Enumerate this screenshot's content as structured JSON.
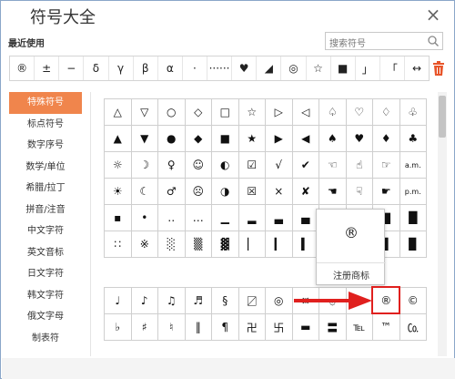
{
  "window": {
    "title": "符号大全",
    "close_glyph": "×"
  },
  "recent": {
    "label": "最近使用",
    "items": [
      "®",
      "±",
      "−",
      "δ",
      "γ",
      "β",
      "α",
      "·",
      "······",
      "♥",
      "◢",
      "◎",
      "☆",
      "■",
      "」",
      "「",
      "↔"
    ]
  },
  "search": {
    "placeholder": "搜索符号"
  },
  "sidebar": {
    "items": [
      {
        "label": "特殊符号",
        "active": true
      },
      {
        "label": "标点符号",
        "active": false
      },
      {
        "label": "数字序号",
        "active": false
      },
      {
        "label": "数学/单位",
        "active": false
      },
      {
        "label": "希腊/拉丁",
        "active": false
      },
      {
        "label": "拼音/注音",
        "active": false
      },
      {
        "label": "中文字符",
        "active": false
      },
      {
        "label": "英文音标",
        "active": false
      },
      {
        "label": "日文字符",
        "active": false
      },
      {
        "label": "韩文字符",
        "active": false
      },
      {
        "label": "俄文字母",
        "active": false
      },
      {
        "label": "制表符",
        "active": false
      }
    ]
  },
  "grid_top": [
    [
      "△",
      "▽",
      "○",
      "◇",
      "□",
      "☆",
      "▷",
      "◁",
      "♤",
      "♡",
      "♢",
      "♧"
    ],
    [
      "▲",
      "▼",
      "●",
      "◆",
      "■",
      "★",
      "▶",
      "◀",
      "♠",
      "♥",
      "♦",
      "♣"
    ],
    [
      "☼",
      "☽",
      "♀",
      "☺",
      "◐",
      "☑",
      "√",
      "✔",
      "☜",
      "☝",
      "☞",
      "a.m."
    ],
    [
      "☀",
      "☾",
      "♂",
      "☹",
      "◑",
      "☒",
      "×",
      "✘",
      "☚",
      "☟",
      "☛",
      "p.m."
    ],
    [
      "▪",
      "•",
      "‥",
      "…",
      "▁",
      "▂",
      "▃",
      "▄",
      "▅",
      "▆",
      "▇",
      "█"
    ],
    [
      "∷",
      "※",
      "░",
      "▒",
      "▓",
      "▏",
      "▎",
      "▍",
      "▌",
      "▋",
      "▊",
      "▉"
    ]
  ],
  "grid_bottom": [
    [
      "♩",
      "♪",
      "♫",
      "♬",
      "§",
      "〼",
      "◎",
      "¤",
      "۞",
      "℗",
      "®",
      "©"
    ],
    [
      "♭",
      "♯",
      "♮",
      "‖",
      "¶",
      "卍",
      "卐",
      "▬",
      "〓",
      "℡",
      "™",
      "㏇"
    ]
  ],
  "popup": {
    "symbol": "®",
    "label": "注册商标"
  },
  "colors": {
    "accent": "#f0854c",
    "highlight": "#e0201e"
  }
}
